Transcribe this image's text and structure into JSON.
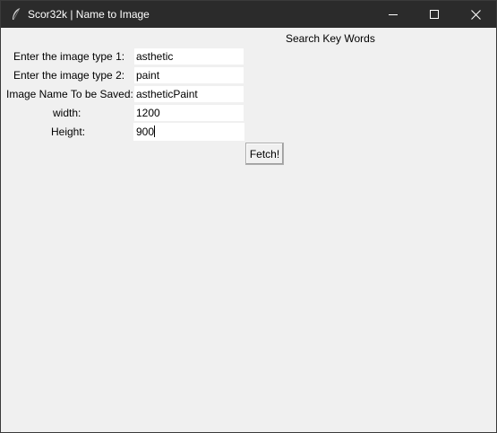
{
  "window": {
    "title": "Scor32k | Name to Image",
    "controls": [
      "minimize-icon",
      "maximize-icon",
      "close-icon"
    ]
  },
  "form": {
    "heading": "Search Key Words",
    "fields": [
      {
        "label": "Enter the image type 1:",
        "value": "asthetic"
      },
      {
        "label": "Enter the image type 2:",
        "value": "paint"
      },
      {
        "label": "Image Name To be Saved:",
        "value": "astheticPaint"
      },
      {
        "label": "width:",
        "value": "1200"
      },
      {
        "label": "Height:",
        "value": "900"
      }
    ],
    "submit_label": "Fetch!"
  },
  "colors": {
    "titlebar": "#2b2b2b",
    "window_bg": "#f0f0f0",
    "input_bg": "#ffffff"
  }
}
